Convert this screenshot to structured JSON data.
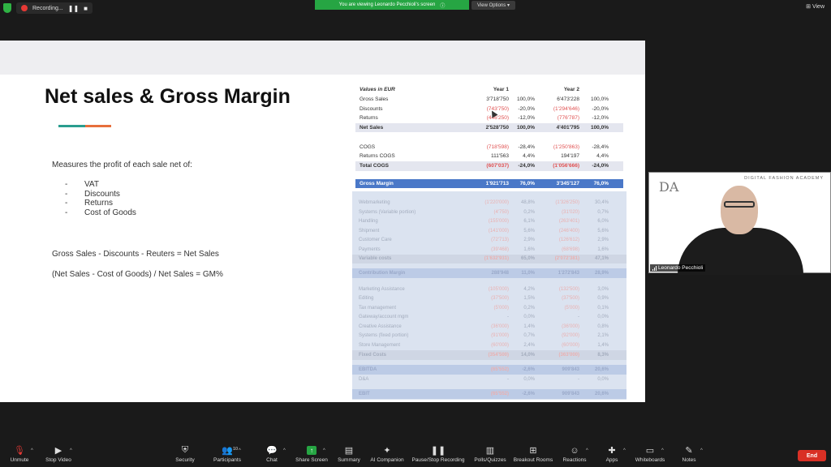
{
  "topbar": {
    "recording_label": "Recording...",
    "viewing_label": "You are viewing Leonardo Pecchioli's screen",
    "view_options": "View Options",
    "view_label": "View",
    "icons": [
      "shield-icon",
      "record-icon",
      "pause-icon",
      "stop-icon",
      "info-icon"
    ]
  },
  "slide": {
    "title": "Net sales & Gross Margin",
    "accent_colors": [
      "#2a9d8f",
      "#e76f3c"
    ],
    "intro": "Measures the profit of each sale net of:",
    "bullets": [
      {
        "dash": "-",
        "text": "VAT"
      },
      {
        "dash": "-",
        "text": "Discounts"
      },
      {
        "dash": "-",
        "text": "Returns"
      },
      {
        "dash": "-",
        "text": "Cost of Goods"
      }
    ],
    "formula1": "Gross Sales - Discounts - Reuters = Net Sales",
    "formula2": "(Net Sales - Cost of Goods) / Net Sales = GM%"
  },
  "table": {
    "header": {
      "label": "Values in EUR",
      "year1": "Year 1",
      "year2": "Year 2"
    },
    "rows": [
      {
        "label": "Gross Sales",
        "v1": "3'718'750",
        "p1": "100,0%",
        "v2": "6'473'228",
        "p2": "100,0%"
      },
      {
        "label": "Discounts",
        "v1": "(743'750)",
        "p1": "-20,0%",
        "v2": "(1'294'646)",
        "p2": "-20,0%"
      },
      {
        "label": "Returns",
        "v1": "(446'250)",
        "p1": "-12,0%",
        "v2": "(776'787)",
        "p2": "-12,0%"
      },
      {
        "label": "Net Sales",
        "v1": "2'528'750",
        "p1": "100,0%",
        "v2": "4'401'795",
        "p2": "100,0%"
      },
      {
        "label": "COGS",
        "v1": "(718'598)",
        "p1": "-28,4%",
        "v2": "(1'250'863)",
        "p2": "-28,4%"
      },
      {
        "label": "Returns COGS",
        "v1": "111'563",
        "p1": "4,4%",
        "v2": "194'197",
        "p2": "4,4%"
      },
      {
        "label": "Total COGS",
        "v1": "(607'037)",
        "p1": "-24,0%",
        "v2": "(1'056'666)",
        "p2": "-24,0%"
      },
      {
        "label": "Gross Margin",
        "v1": "1'921'713",
        "p1": "76,0%",
        "v2": "3'345'127",
        "p2": "76,0%"
      }
    ],
    "faded_rows": [
      {
        "label": "Webmarketing",
        "v1": "(1'220'000)",
        "p1": "48,8%",
        "v2": "(1'326'250)",
        "p2": "30,4%"
      },
      {
        "label": "Systems (Variable portion)",
        "v1": "(4'750)",
        "p1": "0,2%",
        "v2": "(31'020)",
        "p2": "0,7%"
      },
      {
        "label": "Handling",
        "v1": "(155'000)",
        "p1": "6,1%",
        "v2": "(263'401)",
        "p2": "6,0%"
      },
      {
        "label": "Shipment",
        "v1": "(141'000)",
        "p1": "5,6%",
        "v2": "(246'400)",
        "p2": "5,6%"
      },
      {
        "label": "Customer Care",
        "v1": "(72'713)",
        "p1": "2,9%",
        "v2": "(126'612)",
        "p2": "2,9%"
      },
      {
        "label": "Payments",
        "v1": "(39'468)",
        "p1": "1,6%",
        "v2": "(68'698)",
        "p2": "1,6%"
      },
      {
        "label": "Variable costs",
        "v1": "(1'632'931)",
        "p1": "65,0%",
        "v2": "(2'072'381)",
        "p2": "47,1%"
      },
      {
        "label": "Contribution Margin",
        "v1": "288'948",
        "p1": "11,0%",
        "v2": "1'272'843",
        "p2": "28,9%"
      },
      {
        "label": "Marketing Assistance",
        "v1": "(105'000)",
        "p1": "4,2%",
        "v2": "(132'500)",
        "p2": "3,0%"
      },
      {
        "label": "Editing",
        "v1": "(37'500)",
        "p1": "1,5%",
        "v2": "(37'500)",
        "p2": "0,9%"
      },
      {
        "label": "Tax management",
        "v1": "(5'000)",
        "p1": "0,2%",
        "v2": "(5'000)",
        "p2": "0,1%"
      },
      {
        "label": "Gateway/account mgm",
        "v1": "-",
        "p1": "0,0%",
        "v2": "-",
        "p2": "0,0%"
      },
      {
        "label": "Creative Assistance",
        "v1": "(36'000)",
        "p1": "1,4%",
        "v2": "(36'000)",
        "p2": "0,8%"
      },
      {
        "label": "Systems (fixed portion)",
        "v1": "(91'000)",
        "p1": "0,7%",
        "v2": "(92'000)",
        "p2": "2,1%"
      },
      {
        "label": "Store Management",
        "v1": "(60'000)",
        "p1": "2,4%",
        "v2": "(60'000)",
        "p2": "1,4%"
      },
      {
        "label": "Fixed Costs",
        "v1": "(354'500)",
        "p1": "14,0%",
        "v2": "(363'000)",
        "p2": "8,3%"
      },
      {
        "label": "EBITDA",
        "v1": "(65'552)",
        "p1": "-2,6%",
        "v2": "909'843",
        "p2": "20,6%"
      },
      {
        "label": "D&A",
        "v1": "-",
        "p1": "0,0%",
        "v2": "-",
        "p2": "0,0%"
      },
      {
        "label": "EBIT",
        "v1": "(65'552)",
        "p1": "-2,6%",
        "v2": "909'843",
        "p2": "20,6%"
      }
    ]
  },
  "camera": {
    "brand": "DIGITAL FASHION ACADEMY",
    "logo": "DA",
    "name": "Leonardo Pecchioli"
  },
  "toolbar": {
    "items": [
      {
        "name": "unmute-button",
        "label": "Unmute",
        "icon": "mic-off-icon"
      },
      {
        "name": "stop-video-button",
        "label": "Stop Video",
        "icon": "video-camera-icon"
      },
      {
        "name": "security-button",
        "label": "Security",
        "icon": "shield-icon"
      },
      {
        "name": "participants-button",
        "label": "Participants",
        "icon": "people-icon",
        "count": "10"
      },
      {
        "name": "chat-button",
        "label": "Chat",
        "icon": "chat-icon"
      },
      {
        "name": "share-screen-button",
        "label": "Share Screen",
        "icon": "share-screen-icon"
      },
      {
        "name": "summary-button",
        "label": "Summary",
        "icon": "summary-icon"
      },
      {
        "name": "ai-companion-button",
        "label": "AI Companion",
        "icon": "sparkle-icon"
      },
      {
        "name": "pause-stop-recording-button",
        "label": "Pause/Stop Recording",
        "icon": "pause-stop-icon"
      },
      {
        "name": "polls-quizzes-button",
        "label": "Polls/Quizzes",
        "icon": "poll-icon"
      },
      {
        "name": "breakout-rooms-button",
        "label": "Breakout Rooms",
        "icon": "grid-icon"
      },
      {
        "name": "reactions-button",
        "label": "Reactions",
        "icon": "smiley-icon"
      },
      {
        "name": "apps-button",
        "label": "Apps",
        "icon": "apps-icon"
      },
      {
        "name": "whiteboards-button",
        "label": "Whiteboards",
        "icon": "whiteboard-icon"
      },
      {
        "name": "notes-button",
        "label": "Notes",
        "icon": "notes-icon"
      }
    ],
    "end_label": "End"
  }
}
